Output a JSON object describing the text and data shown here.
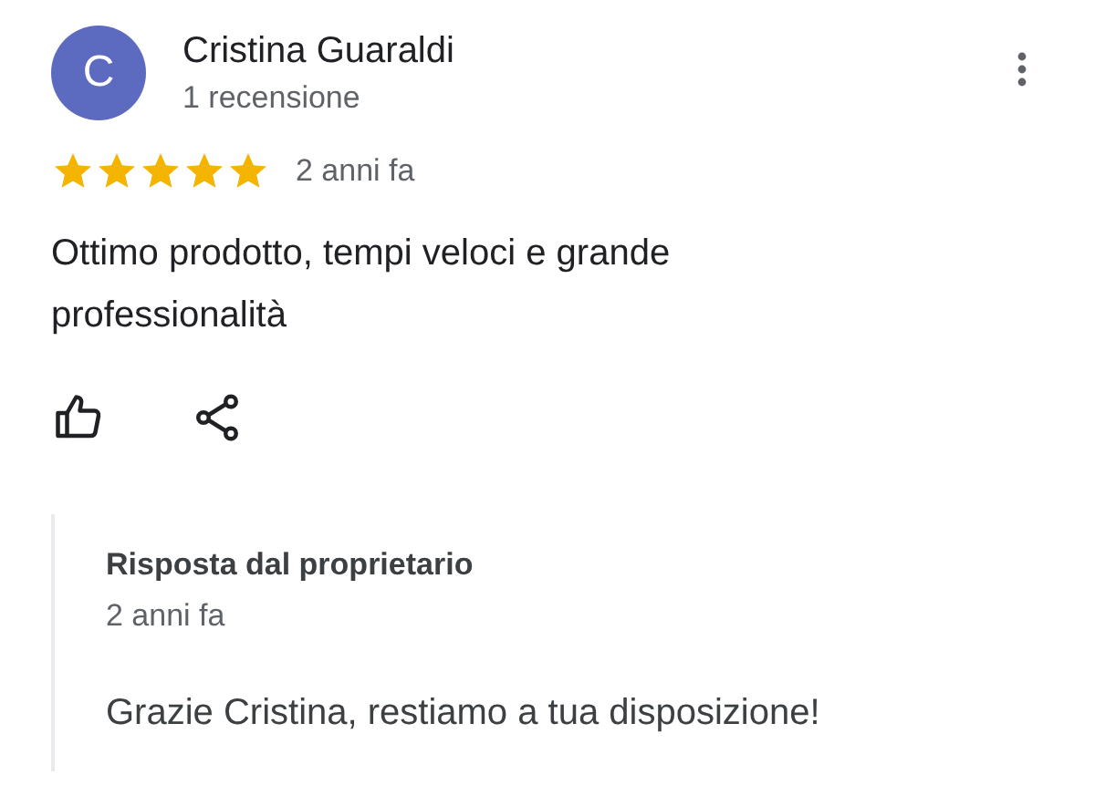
{
  "review": {
    "avatar_letter": "C",
    "author": "Cristina Guaraldi",
    "author_meta": "1 recensione",
    "stars": 5,
    "time": "2 anni fa",
    "text": "Ottimo prodotto, tempi veloci e grande professionalità"
  },
  "owner_reply": {
    "title": "Risposta dal proprietario",
    "time": "2 anni fa",
    "text": "Grazie Cristina, restiamo a tua disposizione!"
  }
}
